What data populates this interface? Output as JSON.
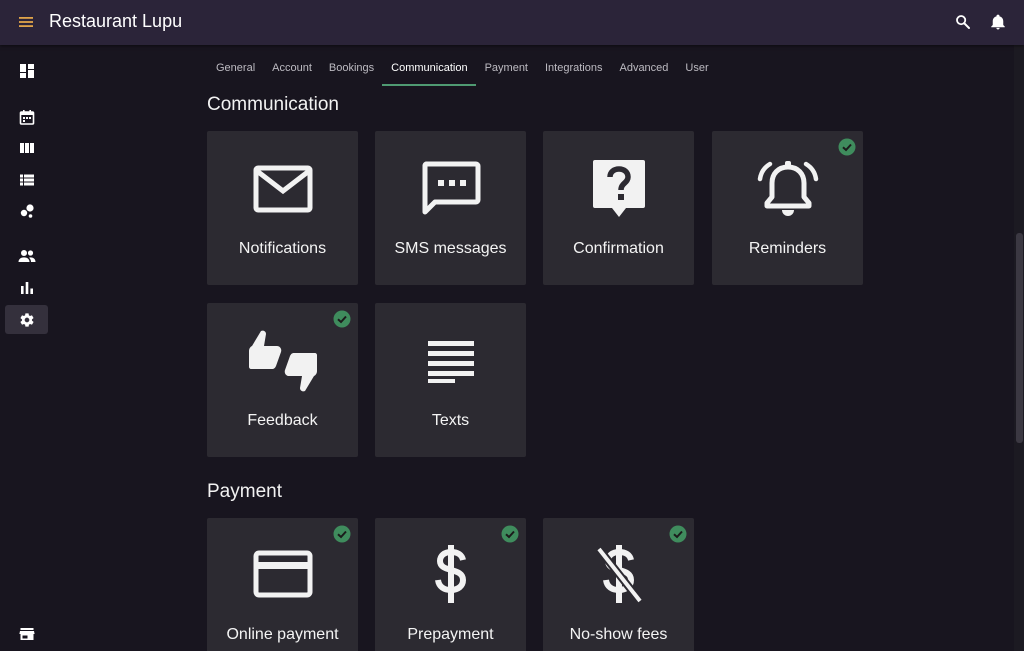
{
  "app": {
    "title": "Restaurant Lupu"
  },
  "tabs": [
    {
      "label": "General"
    },
    {
      "label": "Account"
    },
    {
      "label": "Bookings"
    },
    {
      "label": "Communication"
    },
    {
      "label": "Payment"
    },
    {
      "label": "Integrations"
    },
    {
      "label": "Advanced"
    },
    {
      "label": "User"
    }
  ],
  "active_tab": "Communication",
  "sections": {
    "communication": {
      "title": "Communication",
      "cards": [
        {
          "label": "Notifications",
          "icon": "mail-icon",
          "enabled": false
        },
        {
          "label": "SMS messages",
          "icon": "sms-icon",
          "enabled": false
        },
        {
          "label": "Confirmation",
          "icon": "question-icon",
          "enabled": false
        },
        {
          "label": "Reminders",
          "icon": "alarm-icon",
          "enabled": true
        },
        {
          "label": "Feedback",
          "icon": "thumbs-icon",
          "enabled": true
        },
        {
          "label": "Texts",
          "icon": "text-lines-icon",
          "enabled": false
        }
      ]
    },
    "payment": {
      "title": "Payment",
      "cards": [
        {
          "label": "Online payment",
          "icon": "credit-card-icon",
          "enabled": true
        },
        {
          "label": "Prepayment",
          "icon": "dollar-icon",
          "enabled": true
        },
        {
          "label": "No-show fees",
          "icon": "no-dollar-icon",
          "enabled": true
        }
      ]
    }
  },
  "sidebar": [
    {
      "icon": "dashboard-icon"
    },
    {
      "icon": "calendar-icon"
    },
    {
      "icon": "columns-icon"
    },
    {
      "icon": "list-icon"
    },
    {
      "icon": "bubble-chart-icon"
    },
    {
      "icon": "people-icon"
    },
    {
      "icon": "bar-chart-icon"
    },
    {
      "icon": "settings-icon",
      "active": true
    },
    {
      "icon": "store-icon"
    }
  ],
  "colors": {
    "topbar": "#2b2439",
    "background": "#18151f",
    "card": "#2c2a31",
    "accent": "#4f9a72",
    "check": "#3f8c5d",
    "menu_icon": "#e0a44a"
  }
}
